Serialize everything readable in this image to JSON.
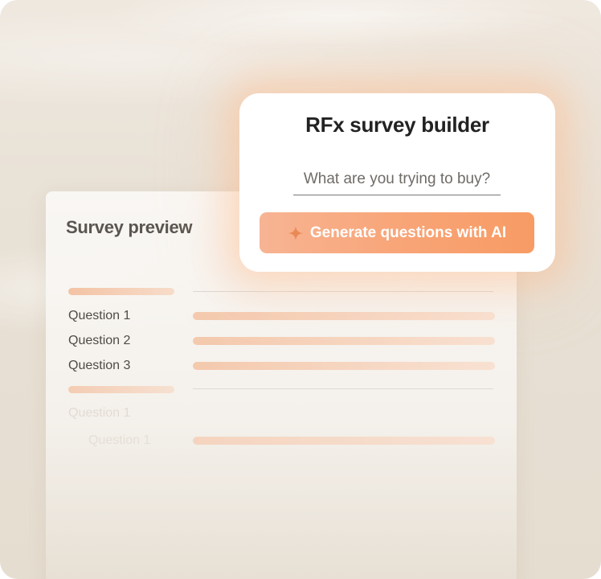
{
  "builder": {
    "title": "RFx survey builder",
    "input_placeholder": "What are you trying to buy?",
    "generate_label": "Generate questions with AI",
    "generate_icon": "sparkle-icon"
  },
  "preview": {
    "title": "Survey preview",
    "questions": [
      "Question 1",
      "Question 2",
      "Question 3"
    ],
    "faded_question": "Question 1",
    "nested_question": "Question 1"
  },
  "colors": {
    "accent": "#f79b64",
    "accent_light": "#f7b493",
    "card_bg": "#ffffff"
  }
}
